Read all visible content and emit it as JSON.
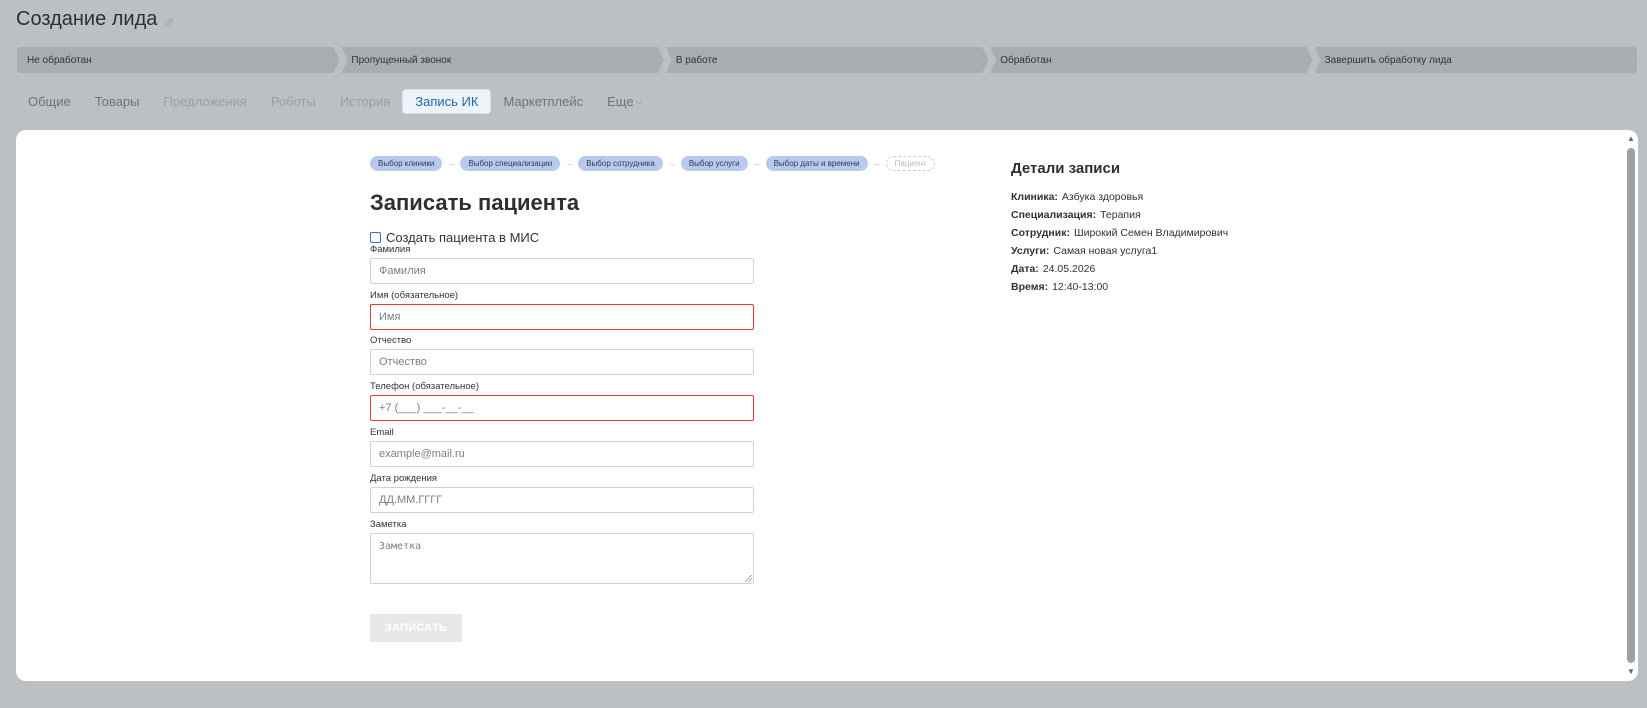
{
  "header": {
    "title": "Создание лида"
  },
  "stages": [
    "Не обработан",
    "Пропущенный звонок",
    "В работе",
    "Обработан",
    "Завершить обработку лида"
  ],
  "tabs": [
    {
      "label": "Общие"
    },
    {
      "label": "Товары"
    },
    {
      "label": "Предложения"
    },
    {
      "label": "Роботы"
    },
    {
      "label": "История"
    },
    {
      "label": "Запись ИК"
    },
    {
      "label": "Маркетплейс"
    },
    {
      "label": "Еще"
    }
  ],
  "steps": [
    "Выбор клиники",
    "Выбор специализации",
    "Выбор сотрудника",
    "Выбор услуги",
    "Выбор даты и времени",
    "Пациент"
  ],
  "form": {
    "title": "Записать пациента",
    "create_in_mis": "Создать пациента в МИС",
    "fields": [
      {
        "label": "Фамилия",
        "placeholder": "Фамилия"
      },
      {
        "label": "Имя (обязательное)",
        "placeholder": "Имя"
      },
      {
        "label": "Отчество",
        "placeholder": "Отчество"
      },
      {
        "label": "Телефон (обязательное)",
        "placeholder": "+7 (___) ___-__-__"
      },
      {
        "label": "Email",
        "placeholder": "example@mail.ru"
      },
      {
        "label": "Дата рождения",
        "placeholder": "ДД.ММ.ГГГГ"
      },
      {
        "label": "Заметка",
        "placeholder": "Заметка"
      }
    ],
    "submit": "ЗАПИСАТЬ"
  },
  "details": {
    "title": "Детали записи",
    "rows": [
      {
        "label": "Клиника:",
        "value": "Азбука здоровья"
      },
      {
        "label": "Специализация:",
        "value": "Терапия"
      },
      {
        "label": "Сотрудник:",
        "value": "Широкий Семен Владимирович"
      },
      {
        "label": "Услуги:",
        "value": "Самая новая услуга1"
      },
      {
        "label": "Дата:",
        "value": "24.05.2026"
      },
      {
        "label": "Время:",
        "value": "12:40-13:00"
      }
    ]
  }
}
